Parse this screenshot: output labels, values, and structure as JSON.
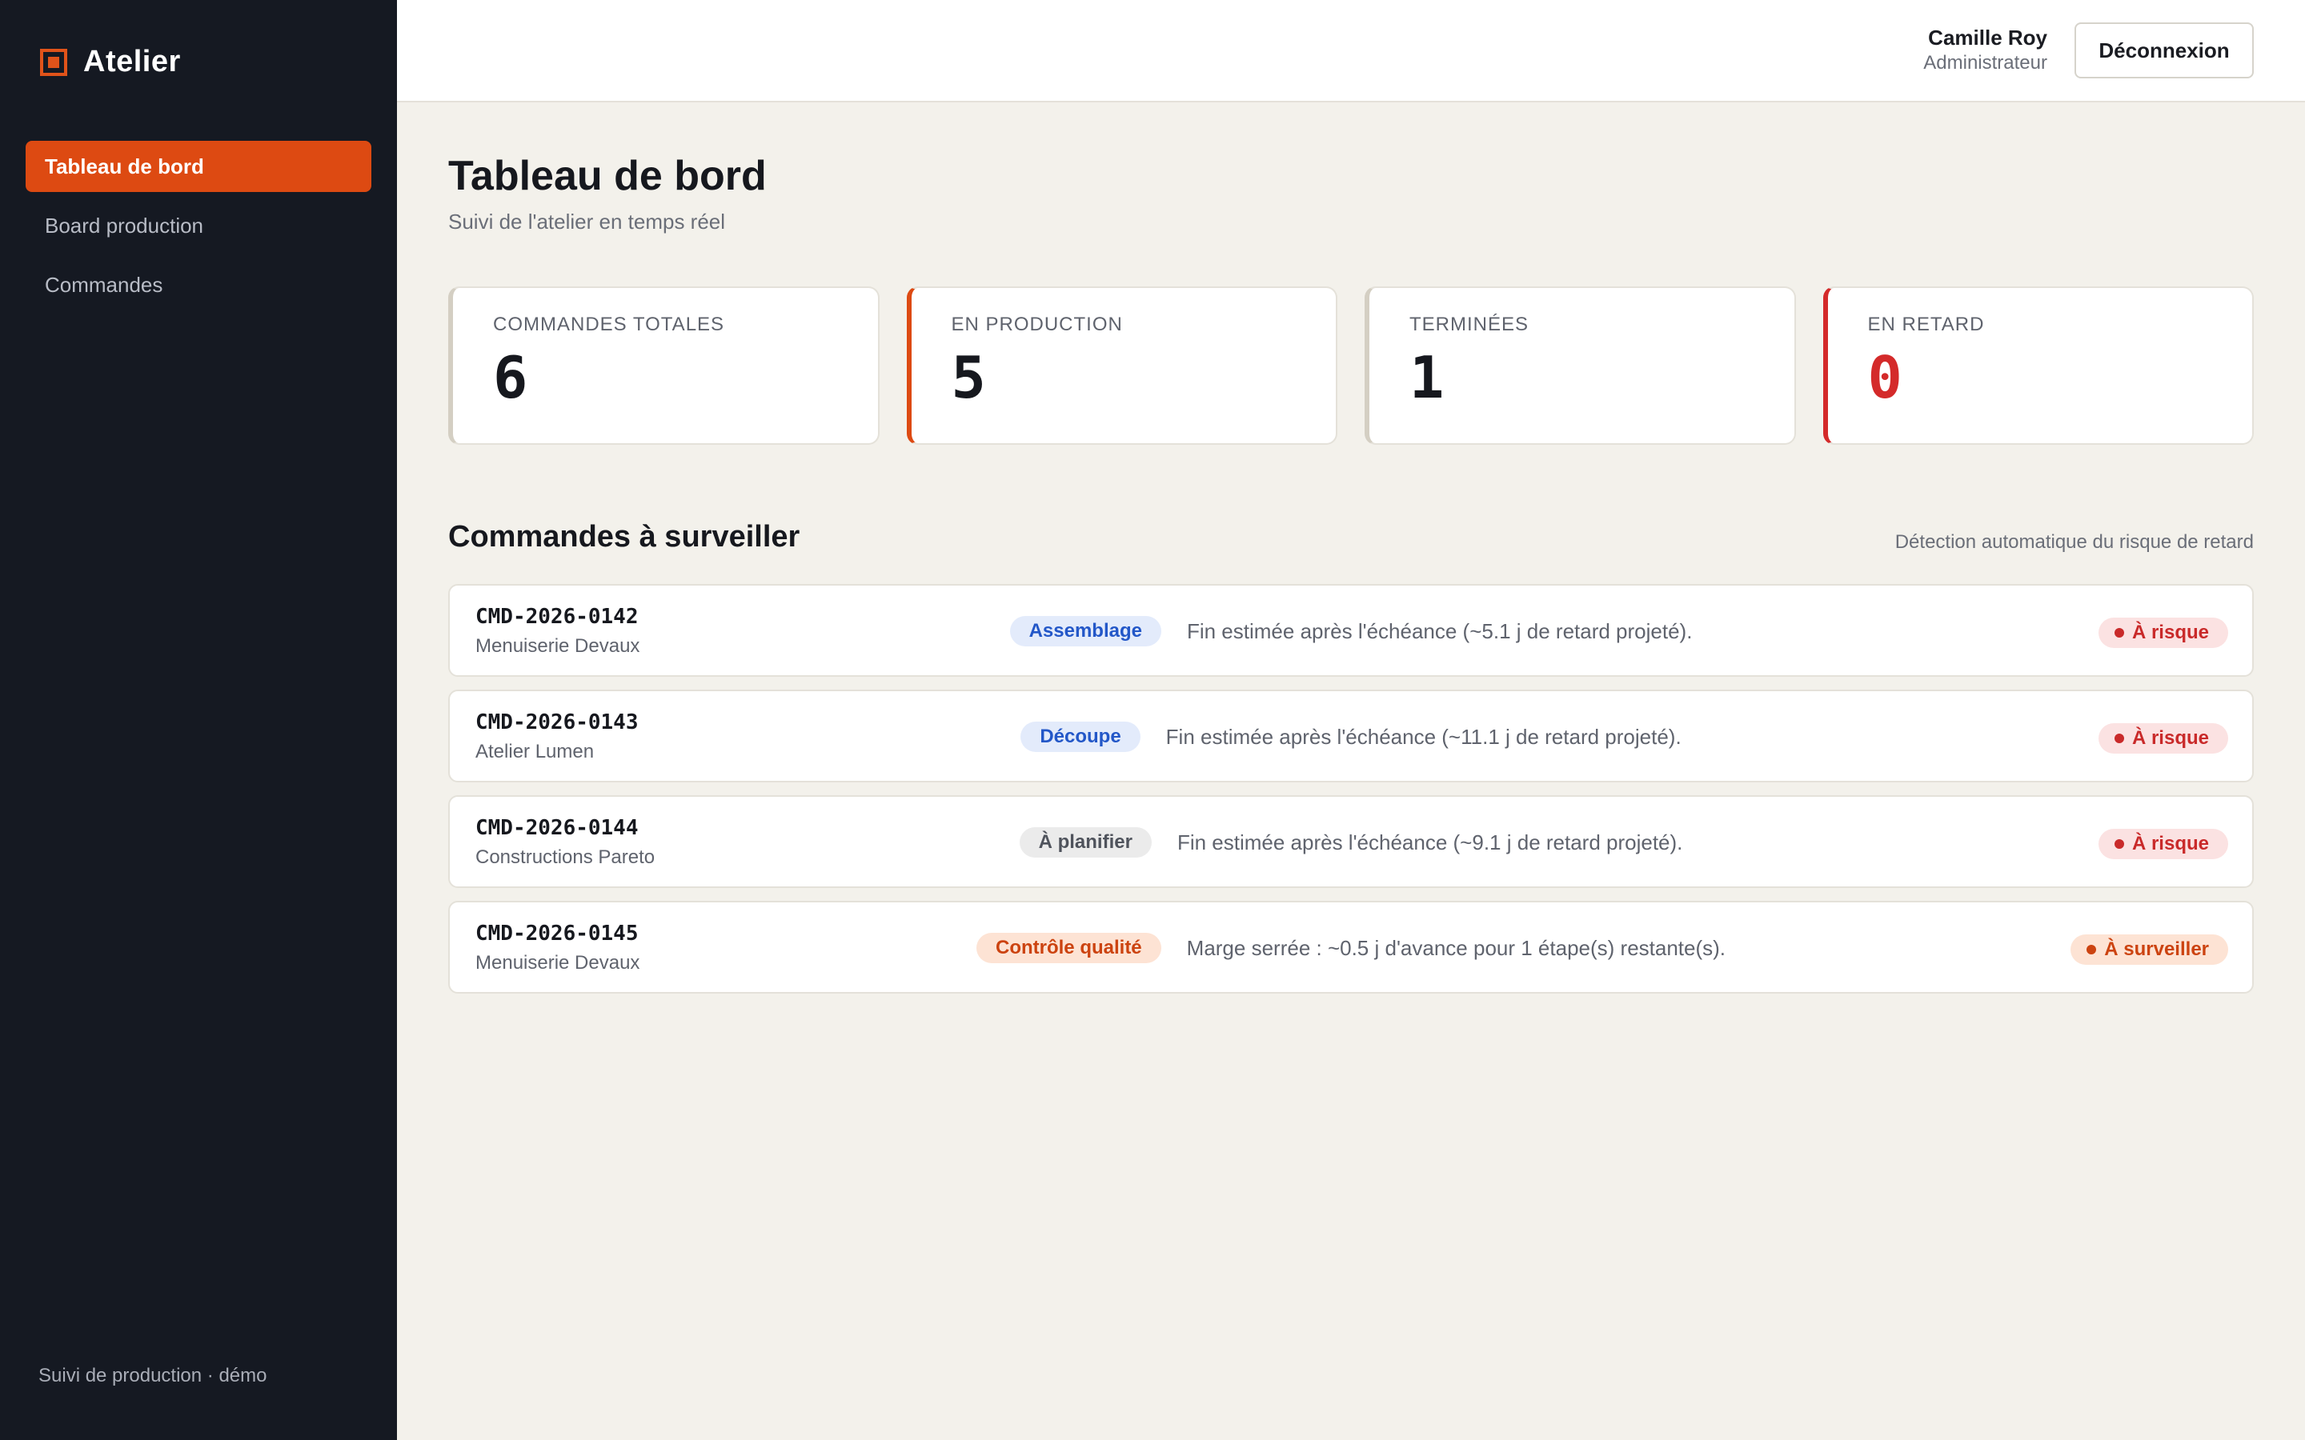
{
  "app": {
    "name": "Atelier"
  },
  "sidebar": {
    "items": [
      {
        "label": "Tableau de bord",
        "active": true
      },
      {
        "label": "Board production",
        "active": false
      },
      {
        "label": "Commandes",
        "active": false
      }
    ],
    "footer": "Suivi de production · démo"
  },
  "header": {
    "user_name": "Camille Roy",
    "user_role": "Administrateur",
    "logout_label": "Déconnexion"
  },
  "page": {
    "title": "Tableau de bord",
    "subtitle": "Suivi de l'atelier en temps réel"
  },
  "stats": [
    {
      "label": "COMMANDES TOTALES",
      "value": "6"
    },
    {
      "label": "EN PRODUCTION",
      "value": "5"
    },
    {
      "label": "TERMINÉES",
      "value": "1"
    },
    {
      "label": "EN RETARD",
      "value": "0"
    }
  ],
  "watch": {
    "title": "Commandes à surveiller",
    "hint": "Détection automatique du risque de retard",
    "orders": [
      {
        "id": "CMD-2026-0142",
        "client": "Menuiserie Devaux",
        "stage": "Assemblage",
        "note": "Fin estimée après l'échéance (~5.1 j de retard projeté).",
        "status": "À risque"
      },
      {
        "id": "CMD-2026-0143",
        "client": "Atelier Lumen",
        "stage": "Découpe",
        "note": "Fin estimée après l'échéance (~11.1 j de retard projeté).",
        "status": "À risque"
      },
      {
        "id": "CMD-2026-0144",
        "client": "Constructions Pareto",
        "stage": "À planifier",
        "note": "Fin estimée après l'échéance (~9.1 j de retard projeté).",
        "status": "À risque"
      },
      {
        "id": "CMD-2026-0145",
        "client": "Menuiserie Devaux",
        "stage": "Contrôle qualité",
        "note": "Marge serrée : ~0.5 j d'avance pour 1 étape(s) restante(s).",
        "status": "À surveiller"
      }
    ]
  },
  "colors": {
    "accent": "#dd4a12",
    "sidebar_bg": "#151922",
    "danger": "#d42a2a",
    "page_bg": "#f3f1eb"
  }
}
